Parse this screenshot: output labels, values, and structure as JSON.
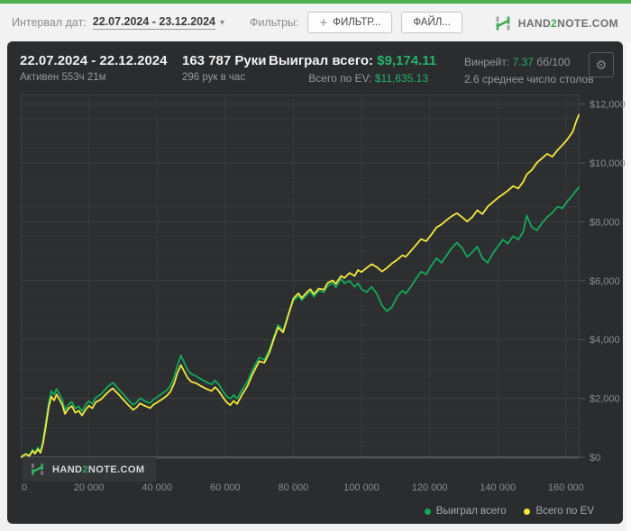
{
  "toolbar": {
    "date_interval_label": "Интервал дат:",
    "date_interval_value": "22.07.2024 - 23.12.2024",
    "filters_label": "Фильтры:",
    "filter_button": "ФИЛЬТР...",
    "file_button": "ФАЙЛ..."
  },
  "brand": {
    "part1": "HAND",
    "part2": "2",
    "part3": "NOTE.COM"
  },
  "icons": {
    "gear": "⚙",
    "dropdown_arrow": "▾",
    "plus": "+"
  },
  "header": {
    "date_range": "22.07.2024 - 22.12.2024",
    "active_time": "Активен 553ч 21м",
    "hands_total": "163 787 Руки",
    "hands_per_hour": "296 рук в час",
    "won_label": "Выиграл всего:",
    "won_value": "$9,174.11",
    "ev_label": "Всего по EV:",
    "ev_value": "$11,635.13",
    "winrate_label": "Винрейт:",
    "winrate_value": "7.37",
    "winrate_units": "бб/100",
    "avg_tables": "2.6 среднее число столов"
  },
  "colors": {
    "accent_green": "#24b36b",
    "line_won": "#13a95c",
    "line_ev": "#f3e93d",
    "panel_bg": "#2b2c2e",
    "top_strip": "#4caf50"
  },
  "chart_data": {
    "type": "line",
    "title": "",
    "xlabel": "",
    "ylabel": "",
    "xlim": [
      0,
      163787
    ],
    "ylim": [
      0,
      12324
    ],
    "grid": true,
    "legend_position": "bottom-right",
    "x_ticks": [
      0,
      20000,
      40000,
      60000,
      80000,
      100000,
      120000,
      140000,
      160000
    ],
    "x_tick_labels": [
      "0",
      "20 000",
      "40 000",
      "60 000",
      "80 000",
      "100 000",
      "120 000",
      "140 000",
      "160 000"
    ],
    "y_ticks": [
      0,
      2000,
      4000,
      6000,
      8000,
      10000,
      12000
    ],
    "y_tick_labels": [
      "$0",
      "$2,000",
      "$4,000",
      "$6,000",
      "$8,000",
      "$10,000",
      "$12,000"
    ],
    "y_minor_step": 500,
    "series": [
      {
        "name": "Выиграл всего",
        "color": "#13a95c",
        "final_value": 9174.11,
        "points": [
          [
            0,
            0
          ],
          [
            1500,
            120
          ],
          [
            2500,
            60
          ],
          [
            3500,
            260
          ],
          [
            4200,
            150
          ],
          [
            5000,
            330
          ],
          [
            5800,
            200
          ],
          [
            6500,
            550
          ],
          [
            7300,
            1150
          ],
          [
            8200,
            1850
          ],
          [
            9000,
            2250
          ],
          [
            9800,
            2120
          ],
          [
            10500,
            2320
          ],
          [
            11300,
            2160
          ],
          [
            12200,
            1950
          ],
          [
            13000,
            1600
          ],
          [
            14000,
            1790
          ],
          [
            15000,
            1880
          ],
          [
            16000,
            1660
          ],
          [
            17000,
            1730
          ],
          [
            18000,
            1560
          ],
          [
            19000,
            1770
          ],
          [
            20000,
            1910
          ],
          [
            21000,
            1810
          ],
          [
            22000,
            2030
          ],
          [
            23500,
            2130
          ],
          [
            25000,
            2330
          ],
          [
            26000,
            2440
          ],
          [
            27000,
            2530
          ],
          [
            28000,
            2410
          ],
          [
            29000,
            2280
          ],
          [
            30000,
            2150
          ],
          [
            31500,
            1950
          ],
          [
            33000,
            1780
          ],
          [
            34000,
            1860
          ],
          [
            35000,
            2010
          ],
          [
            36500,
            1900
          ],
          [
            38000,
            1840
          ],
          [
            39000,
            1960
          ],
          [
            40000,
            2040
          ],
          [
            41500,
            2160
          ],
          [
            43000,
            2290
          ],
          [
            44000,
            2430
          ],
          [
            45000,
            2720
          ],
          [
            46000,
            3120
          ],
          [
            47000,
            3460
          ],
          [
            48000,
            3210
          ],
          [
            49000,
            2960
          ],
          [
            50000,
            2830
          ],
          [
            51500,
            2750
          ],
          [
            53000,
            2650
          ],
          [
            54500,
            2550
          ],
          [
            56000,
            2470
          ],
          [
            57000,
            2610
          ],
          [
            58000,
            2490
          ],
          [
            59500,
            2210
          ],
          [
            60500,
            2060
          ],
          [
            61500,
            1990
          ],
          [
            62500,
            2110
          ],
          [
            63500,
            1990
          ],
          [
            65000,
            2290
          ],
          [
            66500,
            2560
          ],
          [
            68000,
            2960
          ],
          [
            70000,
            3390
          ],
          [
            71500,
            3310
          ],
          [
            73000,
            3660
          ],
          [
            74500,
            4160
          ],
          [
            75500,
            4490
          ],
          [
            77000,
            4310
          ],
          [
            78500,
            4860
          ],
          [
            80000,
            5310
          ],
          [
            81500,
            5490
          ],
          [
            82500,
            5340
          ],
          [
            84000,
            5530
          ],
          [
            85000,
            5630
          ],
          [
            86000,
            5460
          ],
          [
            87500,
            5660
          ],
          [
            89000,
            5610
          ],
          [
            90000,
            5810
          ],
          [
            91500,
            5930
          ],
          [
            92500,
            5770
          ],
          [
            94000,
            6060
          ],
          [
            95000,
            5910
          ],
          [
            96500,
            5990
          ],
          [
            98000,
            5790
          ],
          [
            99000,
            5910
          ],
          [
            100000,
            5710
          ],
          [
            101500,
            5610
          ],
          [
            103000,
            5790
          ],
          [
            104500,
            5560
          ],
          [
            106000,
            5160
          ],
          [
            107500,
            4960
          ],
          [
            109000,
            5110
          ],
          [
            110500,
            5460
          ],
          [
            112000,
            5660
          ],
          [
            113000,
            5560
          ],
          [
            114500,
            5790
          ],
          [
            116000,
            6060
          ],
          [
            117500,
            6310
          ],
          [
            119000,
            6210
          ],
          [
            120500,
            6510
          ],
          [
            122000,
            6760
          ],
          [
            123500,
            6610
          ],
          [
            125000,
            6860
          ],
          [
            126500,
            7110
          ],
          [
            128000,
            7290
          ],
          [
            129500,
            7110
          ],
          [
            131000,
            6810
          ],
          [
            132500,
            6960
          ],
          [
            134000,
            7160
          ],
          [
            135500,
            6760
          ],
          [
            137000,
            6610
          ],
          [
            138500,
            6910
          ],
          [
            140000,
            7160
          ],
          [
            141500,
            7390
          ],
          [
            143000,
            7260
          ],
          [
            144500,
            7510
          ],
          [
            146000,
            7390
          ],
          [
            147500,
            7660
          ],
          [
            148500,
            8210
          ],
          [
            150000,
            7810
          ],
          [
            151500,
            7710
          ],
          [
            153000,
            7960
          ],
          [
            154500,
            8160
          ],
          [
            156000,
            8310
          ],
          [
            157500,
            8510
          ],
          [
            159000,
            8460
          ],
          [
            160500,
            8710
          ],
          [
            162000,
            8900
          ],
          [
            163000,
            9060
          ],
          [
            163787,
            9174
          ]
        ]
      },
      {
        "name": "Всего по EV",
        "color": "#f3e93d",
        "final_value": 11635.13,
        "points": [
          [
            0,
            0
          ],
          [
            1500,
            100
          ],
          [
            2500,
            40
          ],
          [
            3500,
            210
          ],
          [
            4200,
            120
          ],
          [
            5000,
            270
          ],
          [
            5800,
            150
          ],
          [
            6500,
            450
          ],
          [
            7300,
            1000
          ],
          [
            8200,
            1700
          ],
          [
            9000,
            2060
          ],
          [
            9800,
            1930
          ],
          [
            10500,
            2130
          ],
          [
            11300,
            1980
          ],
          [
            12200,
            1780
          ],
          [
            13000,
            1470
          ],
          [
            14000,
            1650
          ],
          [
            15000,
            1740
          ],
          [
            16000,
            1510
          ],
          [
            17000,
            1580
          ],
          [
            18000,
            1420
          ],
          [
            19000,
            1610
          ],
          [
            20000,
            1750
          ],
          [
            21000,
            1660
          ],
          [
            22000,
            1870
          ],
          [
            23500,
            1960
          ],
          [
            25000,
            2140
          ],
          [
            26000,
            2250
          ],
          [
            27000,
            2340
          ],
          [
            28000,
            2220
          ],
          [
            29000,
            2100
          ],
          [
            30000,
            1970
          ],
          [
            31500,
            1780
          ],
          [
            33000,
            1610
          ],
          [
            34000,
            1690
          ],
          [
            35000,
            1830
          ],
          [
            36500,
            1740
          ],
          [
            38000,
            1670
          ],
          [
            39000,
            1790
          ],
          [
            40000,
            1860
          ],
          [
            41500,
            1970
          ],
          [
            43000,
            2100
          ],
          [
            44000,
            2240
          ],
          [
            45000,
            2500
          ],
          [
            46000,
            2870
          ],
          [
            47000,
            3130
          ],
          [
            48000,
            2910
          ],
          [
            49000,
            2690
          ],
          [
            50000,
            2570
          ],
          [
            51500,
            2510
          ],
          [
            53000,
            2410
          ],
          [
            54500,
            2320
          ],
          [
            56000,
            2250
          ],
          [
            57000,
            2380
          ],
          [
            58000,
            2270
          ],
          [
            59500,
            2010
          ],
          [
            60500,
            1860
          ],
          [
            61500,
            1770
          ],
          [
            62500,
            1910
          ],
          [
            63500,
            1810
          ],
          [
            65000,
            2130
          ],
          [
            66500,
            2410
          ],
          [
            68000,
            2810
          ],
          [
            70000,
            3260
          ],
          [
            71500,
            3210
          ],
          [
            73000,
            3560
          ],
          [
            74500,
            4090
          ],
          [
            75500,
            4410
          ],
          [
            77000,
            4240
          ],
          [
            78500,
            4810
          ],
          [
            80000,
            5390
          ],
          [
            81500,
            5570
          ],
          [
            82500,
            5410
          ],
          [
            84000,
            5610
          ],
          [
            85000,
            5710
          ],
          [
            86000,
            5540
          ],
          [
            87500,
            5730
          ],
          [
            89000,
            5690
          ],
          [
            90000,
            5910
          ],
          [
            91500,
            6010
          ],
          [
            92500,
            5890
          ],
          [
            94000,
            6160
          ],
          [
            95000,
            6090
          ],
          [
            96500,
            6260
          ],
          [
            98000,
            6160
          ],
          [
            99000,
            6360
          ],
          [
            100000,
            6290
          ],
          [
            101500,
            6430
          ],
          [
            103000,
            6560
          ],
          [
            104500,
            6460
          ],
          [
            106000,
            6310
          ],
          [
            107500,
            6430
          ],
          [
            109000,
            6590
          ],
          [
            110500,
            6710
          ],
          [
            112000,
            6860
          ],
          [
            113000,
            6810
          ],
          [
            114500,
            7010
          ],
          [
            116000,
            7210
          ],
          [
            117500,
            7410
          ],
          [
            119000,
            7340
          ],
          [
            120500,
            7560
          ],
          [
            122000,
            7810
          ],
          [
            123500,
            7910
          ],
          [
            125000,
            8060
          ],
          [
            126500,
            8190
          ],
          [
            128000,
            8290
          ],
          [
            129500,
            8160
          ],
          [
            131000,
            8010
          ],
          [
            132500,
            8160
          ],
          [
            134000,
            8390
          ],
          [
            135500,
            8260
          ],
          [
            137000,
            8510
          ],
          [
            138500,
            8660
          ],
          [
            140000,
            8810
          ],
          [
            141500,
            8930
          ],
          [
            143000,
            9060
          ],
          [
            144500,
            9210
          ],
          [
            146000,
            9130
          ],
          [
            147500,
            9360
          ],
          [
            148500,
            9610
          ],
          [
            150000,
            9760
          ],
          [
            151500,
            10010
          ],
          [
            153000,
            10160
          ],
          [
            154500,
            10310
          ],
          [
            156000,
            10210
          ],
          [
            157500,
            10430
          ],
          [
            159000,
            10610
          ],
          [
            160500,
            10810
          ],
          [
            162000,
            11060
          ],
          [
            163000,
            11400
          ],
          [
            163787,
            11635
          ]
        ]
      }
    ]
  }
}
